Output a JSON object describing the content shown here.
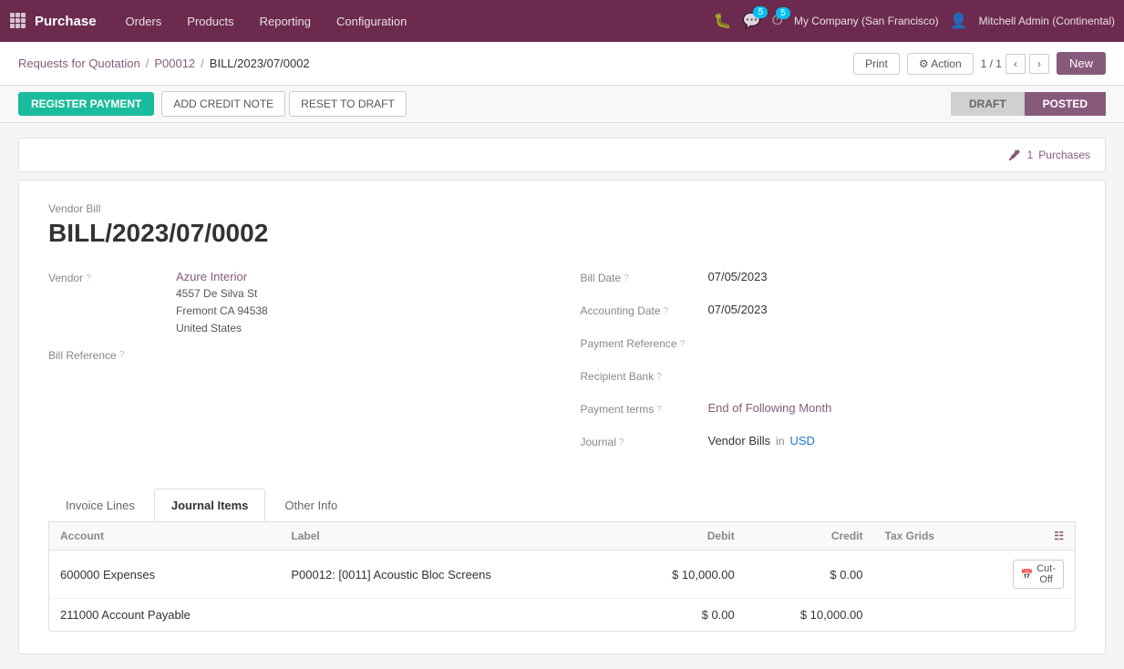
{
  "nav": {
    "app_name": "Purchase",
    "menu_items": [
      "Orders",
      "Products",
      "Reporting",
      "Configuration"
    ],
    "notifications_count": "5",
    "messages_count": "5",
    "company": "My Company (San Francisco)",
    "user": "Mitchell Admin (Continental)"
  },
  "breadcrumb": {
    "rfq": "Requests for Quotation",
    "po_number": "P00012",
    "bill_number": "BILL/2023/07/0002"
  },
  "header_actions": {
    "print": "Print",
    "action": "Action",
    "pager": "1 / 1",
    "new": "New"
  },
  "action_buttons": {
    "register_payment": "REGISTER PAYMENT",
    "add_credit_note": "ADD CREDIT NOTE",
    "reset_to_draft": "RESET TO DRAFT"
  },
  "status": {
    "draft_label": "DRAFT",
    "posted_label": "POSTED"
  },
  "purchases_widget": {
    "count": "1",
    "label": "Purchases"
  },
  "form": {
    "vendor_bill_label": "Vendor Bill",
    "bill_id": "BILL/2023/07/0002",
    "vendor_label": "Vendor",
    "vendor_name": "Azure Interior",
    "vendor_address": "4557 De Silva St\nFremont CA 94538\nUnited States",
    "bill_reference_label": "Bill Reference",
    "bill_date_label": "Bill Date",
    "bill_date": "07/05/2023",
    "accounting_date_label": "Accounting Date",
    "accounting_date": "07/05/2023",
    "payment_reference_label": "Payment Reference",
    "payment_reference_value": "",
    "recipient_bank_label": "Recipient Bank",
    "recipient_bank_value": "",
    "payment_terms_label": "Payment terms",
    "payment_terms_value": "End of Following Month",
    "journal_label": "Journal",
    "journal_value": "Vendor Bills",
    "journal_currency_label": "in",
    "journal_currency": "USD"
  },
  "tabs": [
    {
      "id": "invoice-lines",
      "label": "Invoice Lines",
      "active": false
    },
    {
      "id": "journal-items",
      "label": "Journal Items",
      "active": true
    },
    {
      "id": "other-info",
      "label": "Other Info",
      "active": false
    }
  ],
  "table": {
    "columns": [
      {
        "id": "account",
        "label": "Account"
      },
      {
        "id": "label",
        "label": "Label"
      },
      {
        "id": "debit",
        "label": "Debit",
        "align": "right"
      },
      {
        "id": "credit",
        "label": "Credit",
        "align": "right"
      },
      {
        "id": "tax_grids",
        "label": "Tax Grids"
      }
    ],
    "rows": [
      {
        "account": "600000 Expenses",
        "label": "P00012: [0011] Acoustic Bloc Screens",
        "debit": "$ 10,000.00",
        "credit": "$ 0.00",
        "tax_grids": "",
        "has_cut_off": true,
        "cut_off_label": "Cut-Off"
      },
      {
        "account": "211000 Account Payable",
        "label": "",
        "debit": "$ 0.00",
        "credit": "$ 10,000.00",
        "tax_grids": "",
        "has_cut_off": false,
        "cut_off_label": ""
      }
    ]
  }
}
